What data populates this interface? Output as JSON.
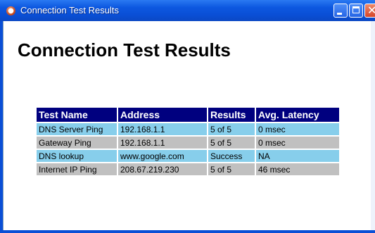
{
  "window": {
    "title": "Connection Test Results",
    "close_glyph": "✕"
  },
  "page": {
    "heading": "Connection Test Results"
  },
  "table": {
    "headers": [
      "Test Name",
      "Address",
      "Results",
      "Avg. Latency"
    ],
    "rows": [
      [
        "DNS Server Ping",
        "192.168.1.1",
        "5 of 5",
        "0 msec"
      ],
      [
        "Gateway Ping",
        "192.168.1.1",
        "5 of 5",
        "0 msec"
      ],
      [
        "DNS lookup",
        "www.google.com",
        "Success",
        "NA"
      ],
      [
        "Internet IP Ping",
        "208.67.219.230",
        "5 of 5",
        "46 msec"
      ]
    ]
  },
  "colors": {
    "header_bg": "#00007f",
    "row_alt_1": "#87ceeb",
    "row_alt_2": "#c0c0c0",
    "title_bar": "#0a4fd6"
  },
  "icons": {
    "app": "app-icon",
    "minimize": "minimize-icon",
    "maximize": "maximize-icon",
    "close": "close-icon"
  }
}
